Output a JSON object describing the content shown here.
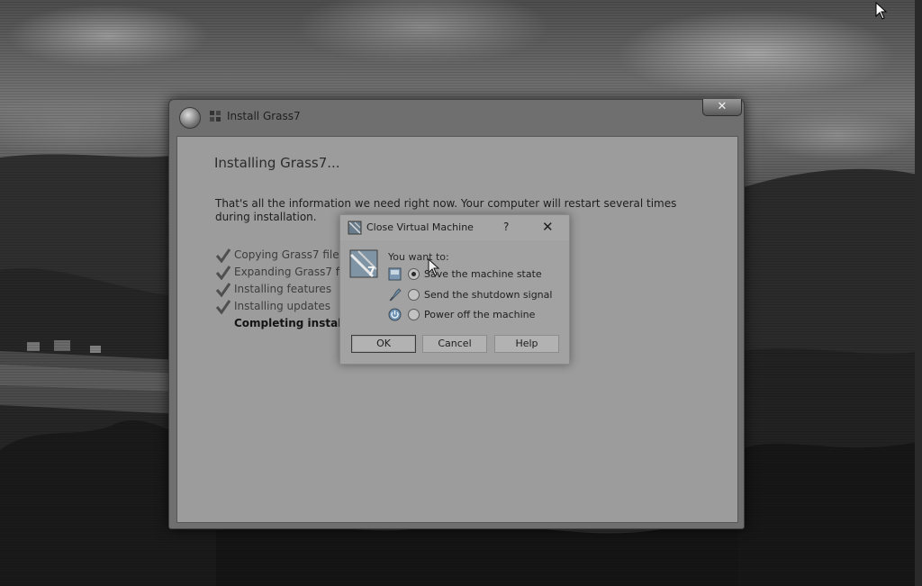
{
  "installer": {
    "title": "Install Grass7",
    "close_glyph": "✕",
    "heading": "Installing Grass7...",
    "info": "That's all the information we need right now. Your computer will restart several times during installation.",
    "steps": [
      {
        "label": "Copying Grass7 files",
        "done": true
      },
      {
        "label": "Expanding Grass7 files",
        "done": true
      },
      {
        "label": "Installing features",
        "done": true
      },
      {
        "label": "Installing updates",
        "done": true
      },
      {
        "label": "Completing installation ...",
        "done": false
      }
    ]
  },
  "dialog": {
    "title": "Close Virtual Machine",
    "help_glyph": "?",
    "close_glyph": "✕",
    "logo_text": "7",
    "prompt": "You want to:",
    "options": [
      {
        "label": "Save the machine state",
        "selected": true,
        "icon": "save-state-icon"
      },
      {
        "label": "Send the shutdown signal",
        "selected": false,
        "icon": "shutdown-signal-icon"
      },
      {
        "label": "Power off the machine",
        "selected": false,
        "icon": "power-off-icon"
      }
    ],
    "buttons": {
      "ok": "OK",
      "cancel": "Cancel",
      "help": "Help"
    }
  },
  "colors": {
    "dialog_bg": "#a2a2a2",
    "window_bg": "#9c9c9c",
    "text": "#1e1e1e"
  }
}
